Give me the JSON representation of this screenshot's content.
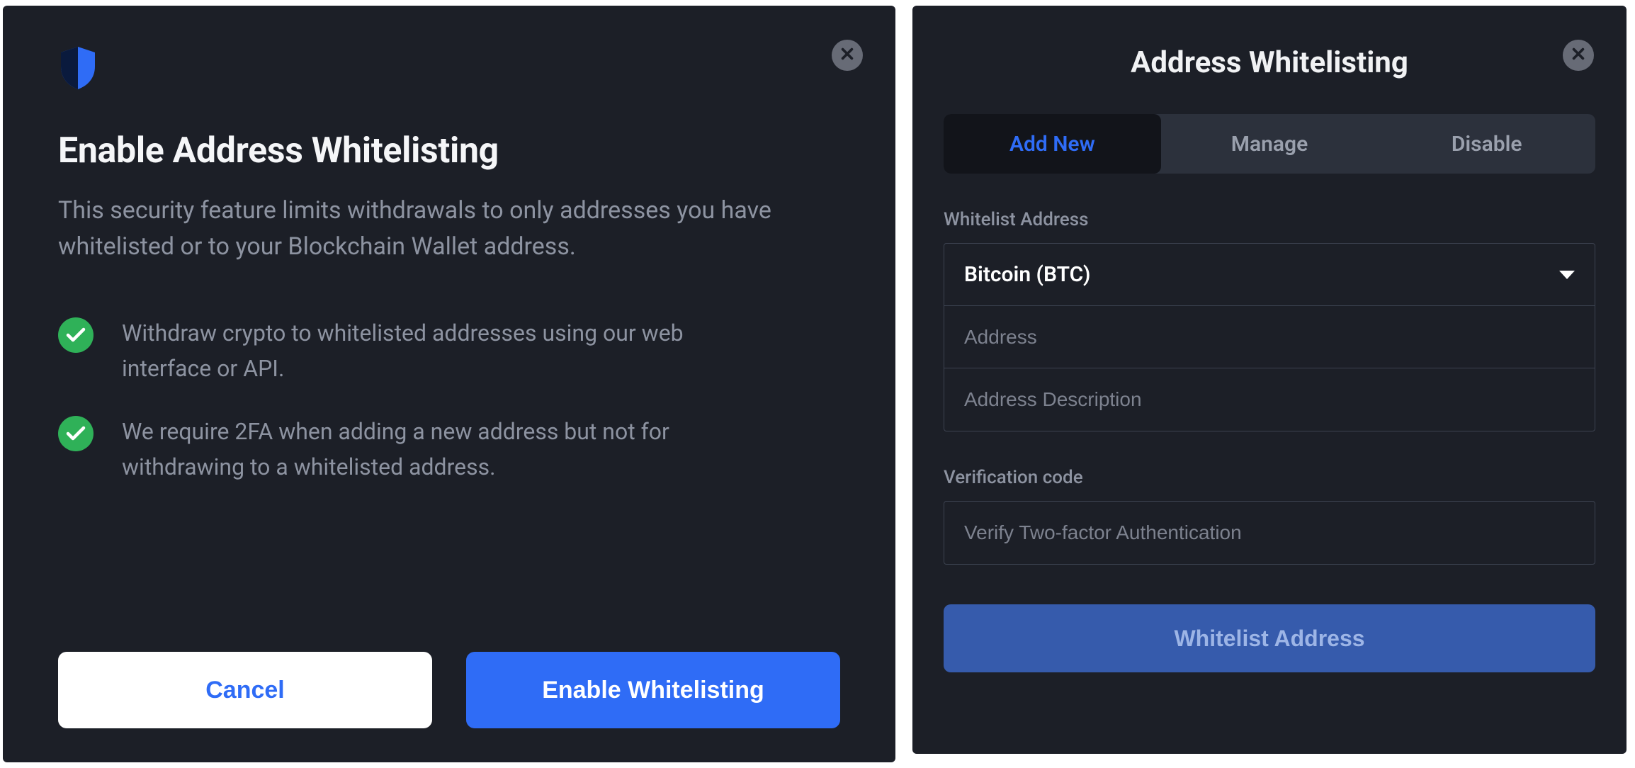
{
  "colors": {
    "panel_bg": "#1c1f27",
    "accent": "#2f6cf6",
    "success": "#2fb158",
    "text_muted": "#8d93a1"
  },
  "left": {
    "icon": "shield-icon",
    "title": "Enable Address Whitelisting",
    "subtitle": "This security feature limits withdrawals to only addresses you have whitelisted or to your Blockchain Wallet address.",
    "features": [
      "Withdraw crypto to whitelisted addresses using our web interface or API.",
      "We require 2FA when adding a new address but not for withdrawing to a whitelisted address."
    ],
    "buttons": {
      "cancel": "Cancel",
      "enable": "Enable Whitelisting"
    }
  },
  "right": {
    "title": "Address Whitelisting",
    "tabs": [
      {
        "label": "Add New",
        "active": true
      },
      {
        "label": "Manage",
        "active": false
      },
      {
        "label": "Disable",
        "active": false
      }
    ],
    "whitelist_section_label": "Whitelist Address",
    "currency_selected": "Bitcoin (BTC)",
    "address_placeholder": "Address",
    "description_placeholder": "Address Description",
    "verification_label": "Verification code",
    "verification_placeholder": "Verify Two-factor Authentication",
    "submit_label": "Whitelist Address"
  }
}
